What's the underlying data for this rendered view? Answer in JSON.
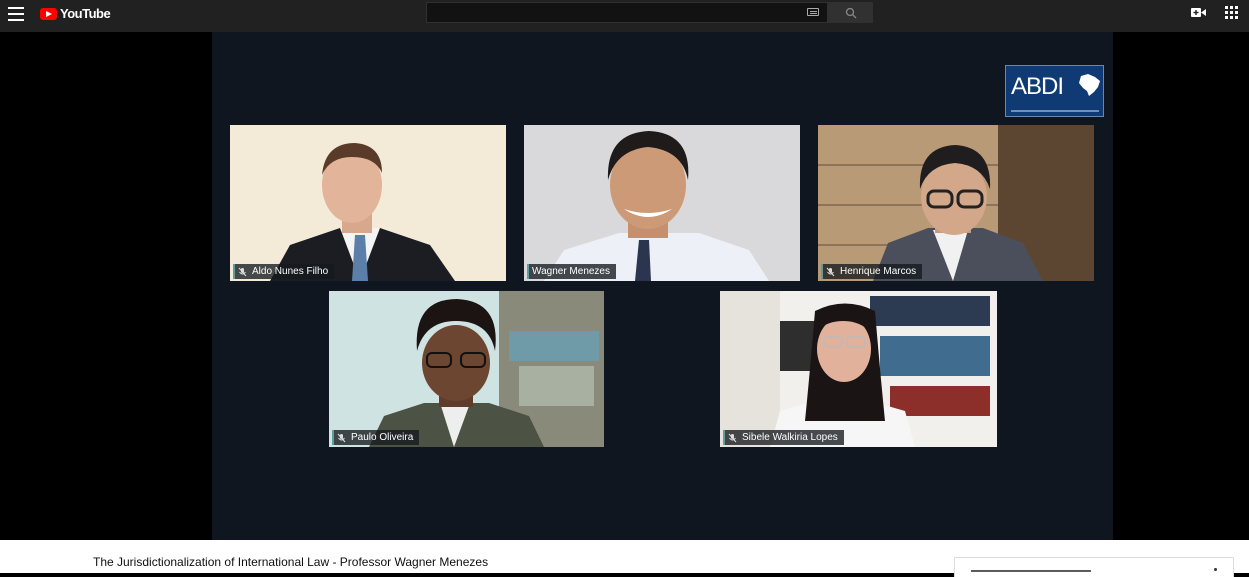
{
  "header": {
    "logo_text": "YouTube",
    "search": {
      "value": "",
      "placeholder": ""
    }
  },
  "video": {
    "brand_logo_text": "ABDI",
    "participants": [
      {
        "name": "Aldo Nunes Filho"
      },
      {
        "name": "Wagner Menezes"
      },
      {
        "name": "Henrique Marcos"
      },
      {
        "name": "Paulo Oliveira"
      },
      {
        "name": "Sibele Walkiria Lopes"
      }
    ]
  },
  "below": {
    "title": "The Jurisdictionalization of International Law - Professor Wagner Menezes"
  },
  "colors": {
    "topbar": "#212121",
    "youtube_red": "#ff0000",
    "frame_bg": "#10161f",
    "abdi_blue": "#0f3a73"
  },
  "icons": [
    "menu-icon",
    "youtube-logo-icon",
    "keyboard-icon",
    "search-icon",
    "create-video-icon",
    "apps-icon",
    "brazil-map-icon",
    "mic-off-icon"
  ]
}
